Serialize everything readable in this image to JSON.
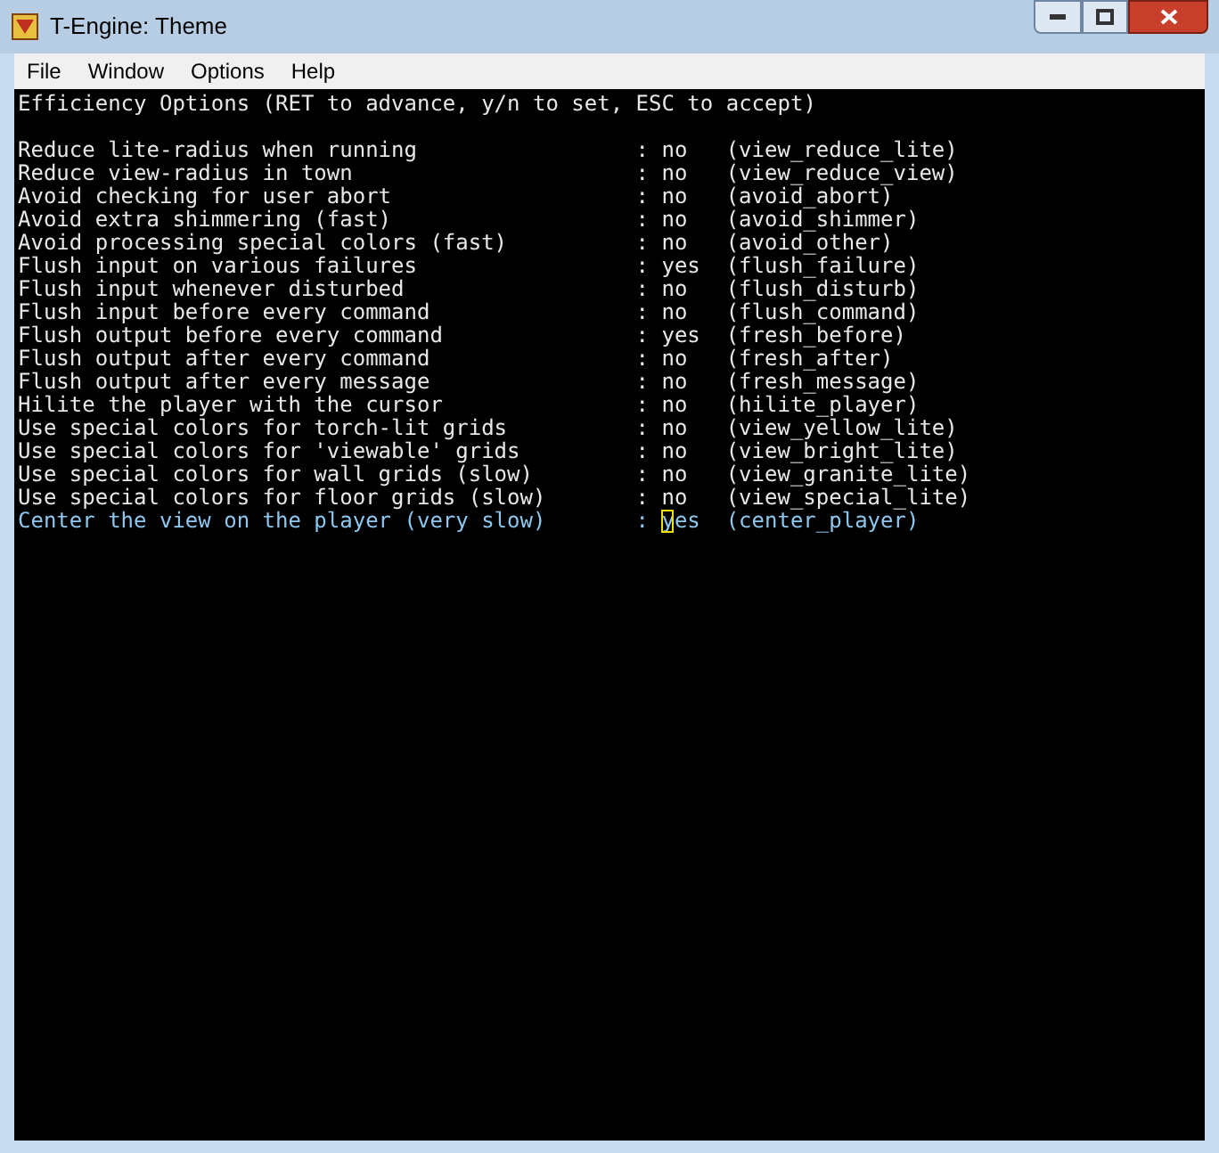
{
  "window": {
    "title": "T-Engine: Theme"
  },
  "menu": [
    "File",
    "Window",
    "Options",
    "Help"
  ],
  "terminal": {
    "header": "Efficiency Options (RET to advance, y/n to set, ESC to accept)",
    "options": [
      {
        "label": "Reduce lite-radius when running",
        "separator": ":",
        "value": "no",
        "key": "(view_reduce_lite)",
        "selected": false
      },
      {
        "label": "Reduce view-radius in town",
        "separator": ":",
        "value": "no",
        "key": "(view_reduce_view)",
        "selected": false
      },
      {
        "label": "Avoid checking for user abort",
        "separator": ":",
        "value": "no",
        "key": "(avoid_abort)",
        "selected": false
      },
      {
        "label": "Avoid extra shimmering (fast)",
        "separator": ":",
        "value": "no",
        "key": "(avoid_shimmer)",
        "selected": false
      },
      {
        "label": "Avoid processing special colors (fast)",
        "separator": ":",
        "value": "no",
        "key": "(avoid_other)",
        "selected": false
      },
      {
        "label": "Flush input on various failures",
        "separator": ":",
        "value": "yes",
        "key": "(flush_failure)",
        "selected": false
      },
      {
        "label": "Flush input whenever disturbed",
        "separator": ":",
        "value": "no",
        "key": "(flush_disturb)",
        "selected": false
      },
      {
        "label": "Flush input before every command",
        "separator": ":",
        "value": "no",
        "key": "(flush_command)",
        "selected": false
      },
      {
        "label": "Flush output before every command",
        "separator": ":",
        "value": "yes",
        "key": "(fresh_before)",
        "selected": false
      },
      {
        "label": "Flush output after every command",
        "separator": ":",
        "value": "no",
        "key": "(fresh_after)",
        "selected": false
      },
      {
        "label": "Flush output after every message",
        "separator": ":",
        "value": "no",
        "key": "(fresh_message)",
        "selected": false
      },
      {
        "label": "Hilite the player with the cursor",
        "separator": ":",
        "value": "no",
        "key": "(hilite_player)",
        "selected": false
      },
      {
        "label": "Use special colors for torch-lit grids",
        "separator": ":",
        "value": "no",
        "key": "(view_yellow_lite)",
        "selected": false
      },
      {
        "label": "Use special colors for 'viewable' grids",
        "separator": ":",
        "value": "no",
        "key": "(view_bright_lite)",
        "selected": false
      },
      {
        "label": "Use special colors for wall grids (slow)",
        "separator": ":",
        "value": "no",
        "key": "(view_granite_lite)",
        "selected": false
      },
      {
        "label": "Use special colors for floor grids (slow)",
        "separator": ":",
        "value": "no",
        "key": "(view_special_lite)",
        "selected": false
      },
      {
        "label": "Center the view on the player (very slow)",
        "separator": ":",
        "value": "yes",
        "key": "(center_player)",
        "selected": true
      }
    ]
  }
}
